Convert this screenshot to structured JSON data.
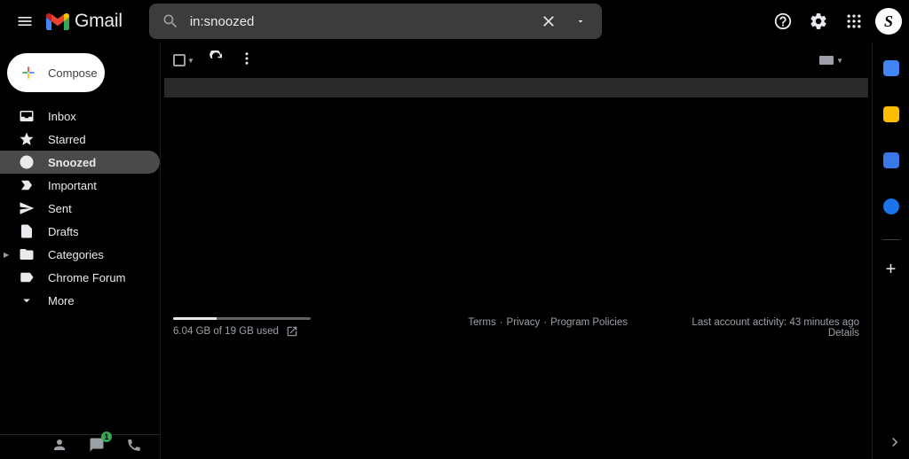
{
  "header": {
    "app_name": "Gmail",
    "search_value": "in:snoozed",
    "avatar_initial": "S"
  },
  "compose_label": "Compose",
  "nav": {
    "items": [
      {
        "label": "Inbox",
        "icon": "inbox"
      },
      {
        "label": "Starred",
        "icon": "star"
      },
      {
        "label": "Snoozed",
        "icon": "clock",
        "selected": true
      },
      {
        "label": "Important",
        "icon": "important"
      },
      {
        "label": "Sent",
        "icon": "sent"
      },
      {
        "label": "Drafts",
        "icon": "drafts"
      },
      {
        "label": "Categories",
        "icon": "categories",
        "expandable": true
      },
      {
        "label": "Chrome Forum",
        "icon": "forum"
      },
      {
        "label": "More",
        "icon": "more"
      }
    ]
  },
  "hangouts_badge": "1",
  "footer": {
    "storage_text": "6.04 GB of 19 GB used",
    "storage_percent": 31.8,
    "links": {
      "terms": "Terms",
      "privacy": "Privacy",
      "policies": "Program Policies"
    },
    "activity_line": "Last account activity: 43 minutes ago",
    "details": "Details"
  }
}
